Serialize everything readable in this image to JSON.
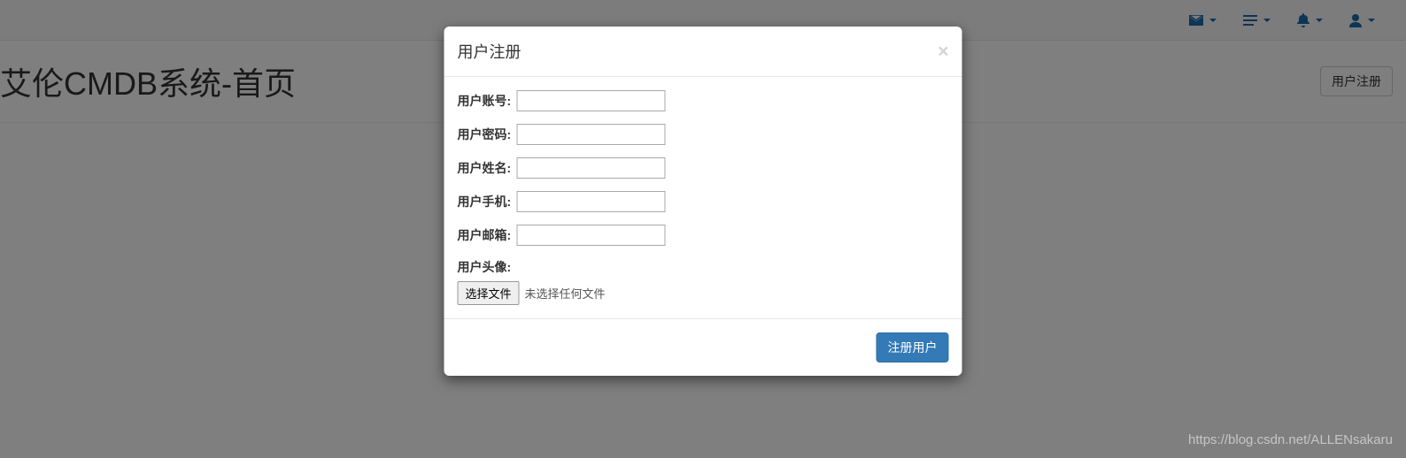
{
  "navbar": {
    "icons": [
      "envelope",
      "list",
      "bell",
      "user"
    ]
  },
  "page": {
    "title": "艾伦CMDB系统-首页",
    "register_button": "用户注册"
  },
  "modal": {
    "title": "用户注册",
    "fields": {
      "account_label": "用户账号:",
      "password_label": "用户密码:",
      "name_label": "用户姓名:",
      "phone_label": "用户手机:",
      "email_label": "用户邮箱:",
      "avatar_label": "用户头像:"
    },
    "file": {
      "button": "选择文件",
      "status": "未选择任何文件"
    },
    "submit": "注册用户"
  },
  "watermark": "https://blog.csdn.net/ALLENsakaru"
}
